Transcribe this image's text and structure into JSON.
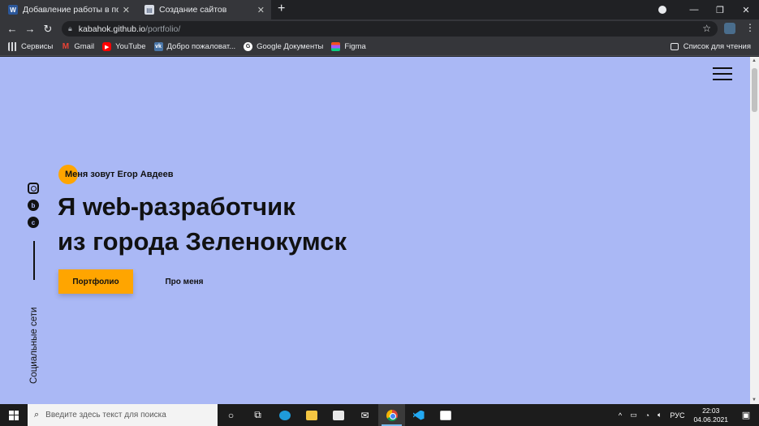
{
  "browser": {
    "tabs": [
      {
        "title": "Добавление работы в портфолио",
        "favicon": "word-icon",
        "close": "✕"
      },
      {
        "title": "Создание сайтов",
        "favicon": "doc-icon",
        "close": "✕"
      }
    ],
    "new_tab": "+",
    "window_controls": {
      "minimize": "—",
      "maximize": "❐",
      "close": "✕"
    },
    "nav": {
      "back": "←",
      "forward": "→",
      "reload": "↻"
    },
    "url": {
      "host": "kabahok.github.io",
      "path": "/portfolio/"
    },
    "bookmarks": [
      {
        "label": "Сервисы",
        "icon": "apps-icon"
      },
      {
        "label": "Gmail",
        "icon": "gmail-icon",
        "glyph": "M"
      },
      {
        "label": "YouTube",
        "icon": "youtube-icon",
        "glyph": "▶"
      },
      {
        "label": "Добро пожаловат...",
        "icon": "vk-icon",
        "glyph": "vk"
      },
      {
        "label": "Google Документы",
        "icon": "google-docs-icon",
        "glyph": "G"
      },
      {
        "label": "Figma",
        "icon": "figma-icon",
        "glyph": ""
      }
    ],
    "reading_list": "Список для чтения"
  },
  "page": {
    "intro": "Меня зовут Егор Авдеев",
    "headline_line1_pre": "Я ",
    "headline_accent": "web-",
    "headline_line1_post": "разработчик",
    "headline_line2": "из города Зеленокумск",
    "portfolio_button": "Портфолио",
    "about_button": "Про меня",
    "social_label": "Социальные сети",
    "social_icons": [
      "instagram-icon",
      "behance-icon",
      "codepen-icon"
    ]
  },
  "taskbar": {
    "search_placeholder": "Введите здесь текст для поиска",
    "language": "РУС",
    "time": "22:03",
    "date": "04.06.2021"
  },
  "colors": {
    "page_bg": "#aab8f5",
    "accent": "#ffa500",
    "text": "#111111"
  }
}
